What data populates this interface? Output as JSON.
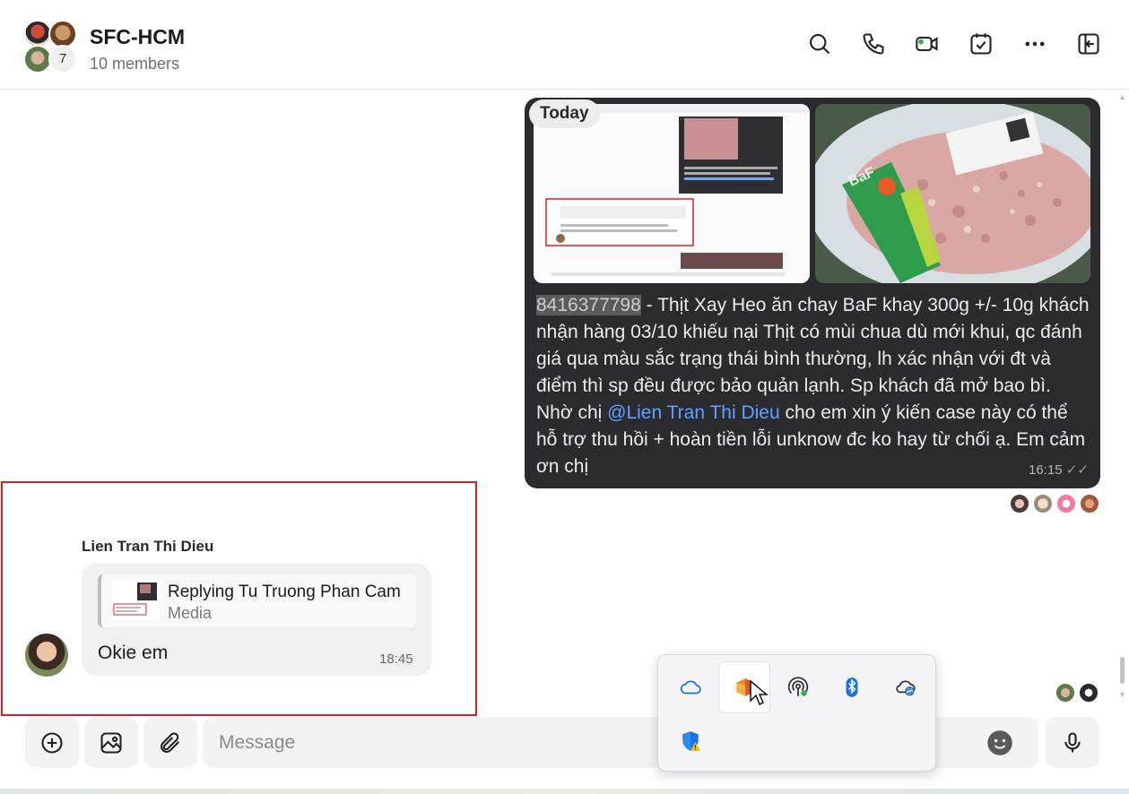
{
  "header": {
    "group_name": "SFC-HCM",
    "members": "10 members",
    "avatar_more_count": "7",
    "actions": [
      {
        "name": "search-icon"
      },
      {
        "name": "phone-icon"
      },
      {
        "name": "video-icon"
      },
      {
        "name": "calendar-check-icon"
      },
      {
        "name": "more-icon"
      },
      {
        "name": "collapse-panel-icon"
      }
    ]
  },
  "chat": {
    "date_divider": "Today",
    "outgoing": {
      "order_id": "8416377798",
      "text_part1": " - Thịt Xay Heo ăn chay BaF khay 300g +/- 10g khách nhận hàng 03/10 khiếu nại Thịt có mùi chua dù mới khui, qc đánh giá qua màu sắc trạng thái bình thường, lh xác nhận với đt và điểm thì sp đều được bảo quản lạnh. Sp khách đã mở bao bì. Nhờ chị ",
      "mention": "@Lien Tran Thi Dieu",
      "text_part2": " cho em xin ý kiến case này có thể hỗ trợ thu hồi + hoàn tiền lỗi unknow đc ko hay từ chối ạ. Em cảm ơn chị",
      "time": "16:15",
      "image_left": "screenshot-chat-attachment",
      "image_right": "minced-meat-tray-photo"
    },
    "incoming": {
      "sender": "Lien Tran Thi Dieu",
      "reply_title": "Replying Tu Truong Phan Cam",
      "reply_subtitle": "Media",
      "text": "Okie em",
      "time": "18:45"
    }
  },
  "composer": {
    "placeholder": "Message",
    "buttons": [
      "add-icon",
      "image-icon",
      "attach-icon",
      "emoji-icon",
      "microphone-icon"
    ]
  },
  "tray": {
    "items": [
      "onedrive-icon",
      "office-app-icon",
      "hotspot-icon",
      "bluetooth-icon",
      "cloud-sync-icon",
      "windows-security-warning-icon"
    ]
  },
  "colors": {
    "bubble_out": "#2b2b2f",
    "mention": "#5ea2ff",
    "highlight_box": "#d61f1f"
  }
}
